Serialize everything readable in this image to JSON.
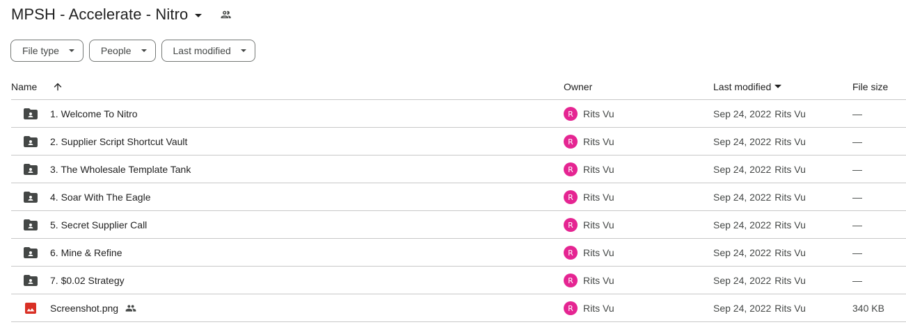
{
  "folder": {
    "title": "MPSH - Accelerate - Nitro",
    "icons": {
      "menu": "chevron-down-icon",
      "shared": "people-icon"
    }
  },
  "filters": [
    {
      "label": "File type"
    },
    {
      "label": "People"
    },
    {
      "label": "Last modified"
    }
  ],
  "columns": {
    "name": "Name",
    "owner": "Owner",
    "modified": "Last modified",
    "size": "File size",
    "sort_icon": "arrow-up-icon"
  },
  "colors": {
    "avatar": "#e52592",
    "folder_icon": "#444746",
    "image_icon": "#d93025"
  },
  "files": [
    {
      "type": "shared-folder",
      "name": "1. Welcome To Nitro",
      "owner_initial": "R",
      "owner": "Rits Vu",
      "modified_date": "Sep 24, 2022",
      "modified_by": "Rits Vu",
      "size": "—",
      "shared": false
    },
    {
      "type": "shared-folder",
      "name": "2. Supplier Script Shortcut Vault",
      "owner_initial": "R",
      "owner": "Rits Vu",
      "modified_date": "Sep 24, 2022",
      "modified_by": "Rits Vu",
      "size": "—",
      "shared": false
    },
    {
      "type": "shared-folder",
      "name": "3. The Wholesale Template Tank",
      "owner_initial": "R",
      "owner": "Rits Vu",
      "modified_date": "Sep 24, 2022",
      "modified_by": "Rits Vu",
      "size": "—",
      "shared": false
    },
    {
      "type": "shared-folder",
      "name": "4. Soar With The Eagle",
      "owner_initial": "R",
      "owner": "Rits Vu",
      "modified_date": "Sep 24, 2022",
      "modified_by": "Rits Vu",
      "size": "—",
      "shared": false
    },
    {
      "type": "shared-folder",
      "name": "5. Secret Supplier Call",
      "owner_initial": "R",
      "owner": "Rits Vu",
      "modified_date": "Sep 24, 2022",
      "modified_by": "Rits Vu",
      "size": "—",
      "shared": false
    },
    {
      "type": "shared-folder",
      "name": "6. Mine & Refine",
      "owner_initial": "R",
      "owner": "Rits Vu",
      "modified_date": "Sep 24, 2022",
      "modified_by": "Rits Vu",
      "size": "—",
      "shared": false
    },
    {
      "type": "shared-folder",
      "name": "7. $0.02 Strategy",
      "owner_initial": "R",
      "owner": "Rits Vu",
      "modified_date": "Sep 24, 2022",
      "modified_by": "Rits Vu",
      "size": "—",
      "shared": false
    },
    {
      "type": "image",
      "name": "Screenshot.png",
      "owner_initial": "R",
      "owner": "Rits Vu",
      "modified_date": "Sep 24, 2022",
      "modified_by": "Rits Vu",
      "size": "340 KB",
      "shared": true
    }
  ]
}
